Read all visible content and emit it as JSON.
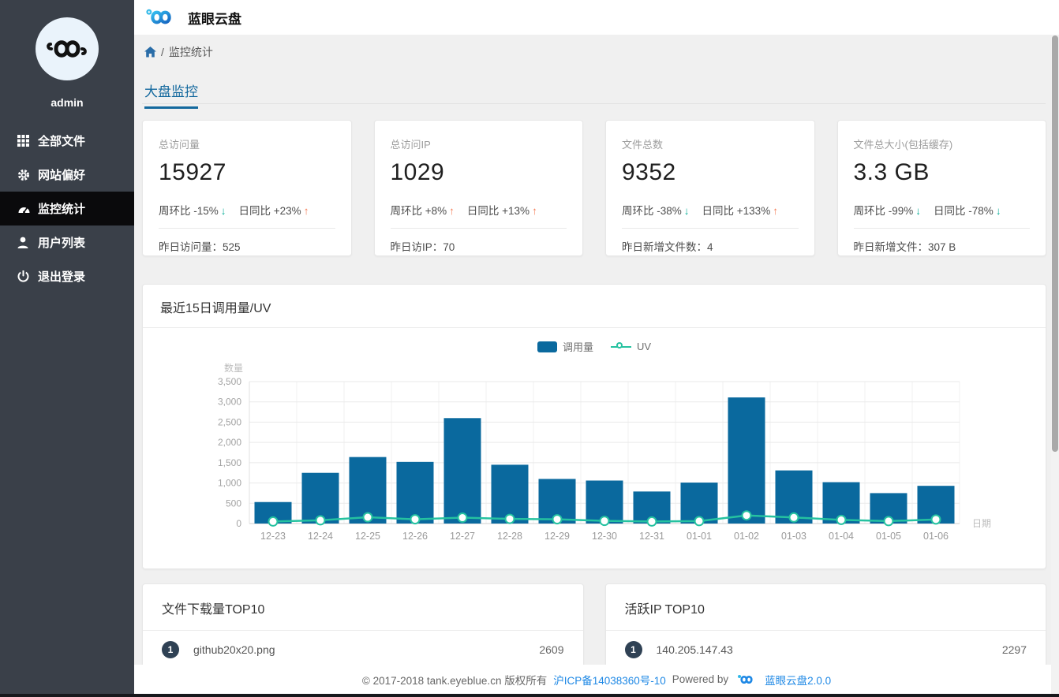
{
  "app": {
    "title": "蓝眼云盘"
  },
  "sidebar": {
    "username": "admin",
    "items": [
      {
        "label": "全部文件",
        "icon": "grid-icon",
        "active": false
      },
      {
        "label": "网站偏好",
        "icon": "gear-icon",
        "active": false
      },
      {
        "label": "监控统计",
        "icon": "dashboard-icon",
        "active": true
      },
      {
        "label": "用户列表",
        "icon": "user-icon",
        "active": false
      },
      {
        "label": "退出登录",
        "icon": "power-icon",
        "active": false
      }
    ]
  },
  "breadcrumb": {
    "separator": "/",
    "current": "监控统计"
  },
  "tab": {
    "label": "大盘监控"
  },
  "cards": [
    {
      "label": "总访问量",
      "value": "15927",
      "trends": [
        {
          "text": "周环比 -15%",
          "arrow": "↓",
          "color": "#00ab95"
        },
        {
          "text": "日同比 +23%",
          "arrow": "↑",
          "color": "#f5815c"
        }
      ],
      "footer_label": "昨日访问量：",
      "footer_value": "525"
    },
    {
      "label": "总访问IP",
      "value": "1029",
      "trends": [
        {
          "text": "周环比 +8%",
          "arrow": "↑",
          "color": "#f5815c"
        },
        {
          "text": "日同比 +13%",
          "arrow": "↑",
          "color": "#f5815c"
        }
      ],
      "footer_label": "昨日访IP：",
      "footer_value": "70"
    },
    {
      "label": "文件总数",
      "value": "9352",
      "trends": [
        {
          "text": "周环比 -38%",
          "arrow": "↓",
          "color": "#00ab95"
        },
        {
          "text": "日同比 +133%",
          "arrow": "↑",
          "color": "#f5815c"
        }
      ],
      "footer_label": "昨日新增文件数：",
      "footer_value": "4"
    },
    {
      "label": "文件总大小(包括缓存)",
      "value": "3.3 GB",
      "trends": [
        {
          "text": "周环比 -99%",
          "arrow": "↓",
          "color": "#00ab95"
        },
        {
          "text": "日同比 -78%",
          "arrow": "↓",
          "color": "#00ab95"
        }
      ],
      "footer_label": "昨日新增文件：",
      "footer_value": "307 B"
    }
  ],
  "chart_panel": {
    "title": "最近15日调用量/UV"
  },
  "chart_data": {
    "type": "bar",
    "title": "最近15日调用量/UV",
    "categories": [
      "12-23",
      "12-24",
      "12-25",
      "12-26",
      "12-27",
      "12-28",
      "12-29",
      "12-30",
      "12-31",
      "01-01",
      "01-02",
      "01-03",
      "01-04",
      "01-05",
      "01-06"
    ],
    "series": [
      {
        "name": "调用量",
        "type": "bar",
        "color": "#0a699e",
        "values": [
          530,
          1250,
          1640,
          1520,
          2600,
          1450,
          1100,
          1060,
          790,
          1010,
          3110,
          1310,
          1020,
          750,
          930
        ]
      },
      {
        "name": "UV",
        "type": "line",
        "color": "#25c2a0",
        "values": [
          50,
          80,
          155,
          105,
          145,
          115,
          105,
          65,
          50,
          60,
          200,
          150,
          90,
          60,
          100
        ]
      }
    ],
    "xlabel": "日期",
    "ylabel": "数量",
    "ylim": [
      0,
      3500
    ],
    "ytick_step": 500,
    "grid": true,
    "legend_position": "top-center"
  },
  "lists": [
    {
      "title": "文件下载量TOP10",
      "rows": [
        {
          "rank": "1",
          "name": "github20x20.png",
          "value": "2609"
        }
      ]
    },
    {
      "title": "活跃IP TOP10",
      "rows": [
        {
          "rank": "1",
          "name": "140.205.147.43",
          "value": "2297"
        }
      ]
    }
  ],
  "footer": {
    "copyright": "© 2017-2018 tank.eyeblue.cn 版权所有",
    "icp_link": "沪ICP备14038360号-10",
    "powered_by": "Powered by",
    "version_link": "蓝眼云盘2.0.0"
  },
  "colors": {
    "sidebar_bg": "#3a4049",
    "sidebar_active_bg": "#0a0a0c",
    "accent_blue": "#14699e",
    "link_blue": "#1e88e5",
    "bar_blue": "#0a699e",
    "line_teal": "#25c2a0",
    "trend_up": "#f5815c",
    "trend_down": "#00ab95"
  }
}
